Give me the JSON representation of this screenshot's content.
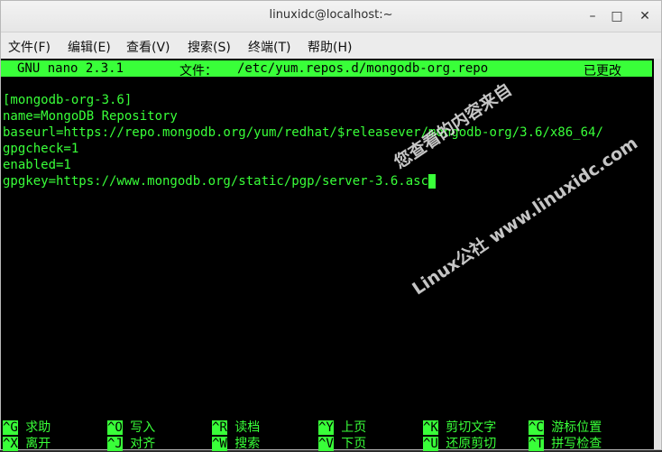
{
  "window": {
    "title": "linuxidc@localhost:~"
  },
  "menu": [
    "文件(F)",
    "编辑(E)",
    "查看(V)",
    "搜索(S)",
    "终端(T)",
    "帮助(H)"
  ],
  "nano": {
    "version_label": "GNU nano 2.3.1",
    "file_label": "文件：",
    "file_path": "/etc/yum.repos.d/mongodb-org.repo",
    "modified": "已更改"
  },
  "content": [
    "[mongodb-org-3.6]",
    "name=MongoDB Repository",
    "baseurl=https://repo.mongodb.org/yum/redhat/$releasever/mongodb-org/3.6/x86_64/",
    "gpgcheck=1",
    "enabled=1",
    "gpgkey=https://www.mongodb.org/static/pgp/server-3.6.asc"
  ],
  "watermark": {
    "line1": "您查看的内容来自",
    "line2": "Linux公社 www.linuxidc.com"
  },
  "shortcuts": [
    {
      "key": "^G",
      "label": "求助"
    },
    {
      "key": "^O",
      "label": "写入"
    },
    {
      "key": "^R",
      "label": "读档"
    },
    {
      "key": "^Y",
      "label": "上页"
    },
    {
      "key": "^K",
      "label": "剪切文字"
    },
    {
      "key": "^C",
      "label": "游标位置"
    },
    {
      "key": "^X",
      "label": "离开"
    },
    {
      "key": "^J",
      "label": "对齐"
    },
    {
      "key": "^W",
      "label": "搜索"
    },
    {
      "key": "^V",
      "label": "下页"
    },
    {
      "key": "^U",
      "label": "还原剪切"
    },
    {
      "key": "^T",
      "label": "拼写检查"
    }
  ],
  "colors": {
    "terminal_bg": "#000000",
    "terminal_fg": "#39ff39"
  }
}
